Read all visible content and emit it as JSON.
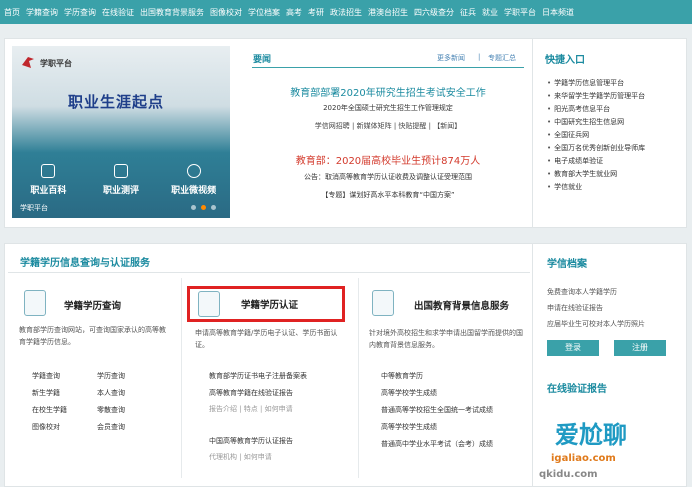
{
  "nav": [
    "首页",
    "学籍查询",
    "学历查询",
    "在线验证",
    "出国教育背景服务",
    "图像校对",
    "学位档案",
    "高考",
    "考研",
    "政法招生",
    "港澳台招生",
    "四六级查分",
    "征兵",
    "就业",
    "学职平台",
    "日本频道"
  ],
  "banner": {
    "logo": "学职平台",
    "title": "职业生涯起点",
    "cards": [
      "职业百科",
      "职业测评",
      "职业微视频"
    ],
    "footer": "学职平台"
  },
  "news": {
    "title": "要闻",
    "more": "更多新闻",
    "special": "专题汇总",
    "headline1": "教育部部署2020年研究生招生考试安全工作",
    "sub1": "2020年全国硕士研究生招生工作管理规定",
    "links1": "学信网招聘 | 新媒体矩阵 | 快贴提醒 | 【新闻】",
    "headline2": "教育部：2020届高校毕业生预计874万人",
    "sub2": "公告：取消高等教育学历认证收费及调整认证受理范围",
    "sub3": "【专题】谋划好高水平本科教育“中国方案”"
  },
  "quick": {
    "title": "快捷入口",
    "items": [
      "学籍学历信息管理平台",
      "来华留学生学籍学历管理平台",
      "阳光高考信息平台",
      "中国研究生招生信息网",
      "全国征兵网",
      "全国万名优秀创新创业导师库",
      "电子成绩单验证",
      "教育部大学生就业网",
      "学信就业"
    ]
  },
  "services": {
    "section_title": "学籍学历信息查询与认证服务",
    "query": {
      "title": "学籍学历查询",
      "desc": "教育部学历查询网站，可查询国家承认的高等教育学籍学历信息。",
      "links": [
        [
          "学籍查询",
          "学历查询"
        ],
        [
          "新生学籍",
          "本人查询"
        ],
        [
          "在校生学籍",
          "零散查询"
        ],
        [
          "图像校对",
          "会员查询"
        ]
      ]
    },
    "auth": {
      "title": "学籍学历认证",
      "desc": "申请高等教育学籍/学历电子认证、学历书面认证。",
      "link1": "教育部学历证书电子注册备案表",
      "link2": "高等教育学籍在线验证报告",
      "link2_sub": "报告介绍 | 特点 | 如何申请",
      "link3": "中国高等教育学历认证报告",
      "link3_sub": "代理机构 | 如何申请"
    },
    "abroad": {
      "title": "出国教育背景信息服务",
      "desc": "针对境外高校招生和求学申请出国留学而提供的国内教育背景信息服务。",
      "links": [
        "中等教育学历",
        "高等学校学生成绩",
        "普通高等学校招生全国统一考试成绩",
        "高等学校学生成绩",
        "普通高中学业水平考试（会考）成绩"
      ]
    }
  },
  "archive": {
    "title": "学信档案",
    "lines": [
      "免费查询本人学籍学历",
      "申请在线验证报告",
      "应届毕业生可校对本人学历照片"
    ],
    "login": "登录",
    "register": "注册"
  },
  "report": {
    "title": "在线验证报告"
  },
  "watermark": {
    "brand": "爱尬聊",
    "url": "igaliao.com",
    "url2": "qkidu.com"
  },
  "colors": {
    "nav": "#3aa1a9",
    "highlight": "#e02222",
    "accent": "#1c8ba0"
  }
}
